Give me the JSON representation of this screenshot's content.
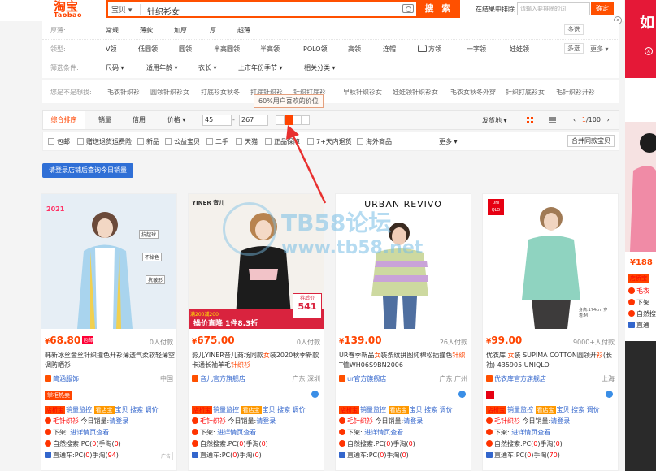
{
  "search": {
    "logo_cn": "淘宝",
    "logo_en": "Taobao",
    "category": "宝贝",
    "query": "针织衫女",
    "button": "搜 索",
    "exclude_label": "在结果中排除",
    "exclude_placeholder": "请输入要排除的词",
    "exclude_button": "确定",
    "close": "×"
  },
  "filters": {
    "row1": {
      "options": [
        "常规",
        "薄款",
        "加厚",
        "厚",
        "超薄"
      ],
      "more": "多选"
    },
    "row2": {
      "label": "领型:",
      "options": [
        "V领",
        "低圆领",
        "圆领",
        "半高圆领",
        "半高领",
        "POLO领",
        "高领",
        "连帽",
        "方领",
        "一字领",
        "娃娃领"
      ],
      "multi": "多选",
      "more": "更多"
    },
    "row3": {
      "label": "筛选条件:",
      "options": [
        "尺码",
        "适用年龄",
        "衣长",
        "上市年份季节",
        "相关分类"
      ]
    }
  },
  "suggest": {
    "label": "您是不是想找:",
    "items": [
      "毛衣针织衫",
      "圆领针织衫女",
      "打底衫女秋冬",
      "打底针织衫",
      "针织打底衫",
      "早秋针织衫女",
      "娃娃领针织衫女",
      "毛衣女秋冬外穿",
      "针织打底衫女",
      "毛针织衫开衫"
    ]
  },
  "tooltip": "60%用户喜欢的价位",
  "sortbar": {
    "tabs": [
      "综合排序",
      "销量",
      "信用",
      "价格"
    ],
    "price_min": "45",
    "price_max": "267",
    "dash": "-",
    "ship_from": "发货地",
    "page_current": "1",
    "page_total": "/100"
  },
  "checks": [
    "包邮",
    "赠送退货运费险",
    "新品",
    "公益宝贝",
    "二手",
    "天猫",
    "正品保障",
    "7+天内退货",
    "海外商品"
  ],
  "checks_more": "更多",
  "merge_button": "合并同款宝贝",
  "login_button": "请登录店铺后查询今日销量",
  "products": [
    {
      "price": "68.80",
      "badge": "包邮",
      "paid": "0人付款",
      "title_parts": [
        "韩新冰丝金丝针织撞色开衫薄透气柔软轻薄空调防晒衫"
      ],
      "shop": "简涵服饰",
      "location": "中国",
      "hot": "掌柜热卖",
      "img_year": "2021",
      "img_tags": [
        "抗起球",
        "不掉色",
        "抗皱形"
      ],
      "pc": "0",
      "mobile": "0",
      "ztc_pc": "0",
      "ztc_mobile": "94",
      "ad": "广告"
    },
    {
      "price": "675.00",
      "paid": "0人付款",
      "title_parts": [
        "影儿YINER音儿商场同款",
        "女",
        "装2020秋季新款卡通长袖羊毛",
        "针织衫"
      ],
      "shop": "音儿官方旗舰店",
      "location": "广东 深圳",
      "img_brand": "YINER 音儿",
      "img_banner": "券后价",
      "img_price": "541",
      "img_promo": "操价直降 1件8.3折",
      "img_coupon": "满200减200",
      "pc": "0",
      "mobile": "0",
      "ztc_pc": "0",
      "ztc_mobile": "0"
    },
    {
      "price": "139.00",
      "paid": "26人付款",
      "title_parts": [
        "UR春季新品",
        "女",
        "装条纹拼图纯棉松插撞色",
        "针织",
        "T恤WH06S9BN2006"
      ],
      "shop": "ur官方旗舰店",
      "location": "广东 广州",
      "img_brand": "URBAN REVIVO",
      "pc": "0",
      "mobile": "0",
      "ztc_pc": "0",
      "ztc_mobile": "0"
    },
    {
      "price": "99.00",
      "paid": "9000+人付款",
      "title_parts": [
        "优衣库 ",
        "女",
        "装 SUPIMA COTTON圆领开",
        "衫",
        "(长袖) 435905 UNIQLO"
      ],
      "shop": "优衣库官方旗舰店",
      "location": "上海",
      "img_brand": "UNI QLO",
      "img_note": "身高:174cm 穿着:M",
      "pc": "0",
      "mobile": "0",
      "ztc_pc": "0",
      "ztc_mobile": "70"
    }
  ],
  "tools": {
    "shop_analysis": "店析宝",
    "sales_monitor": "销量监控",
    "view_shop": "看店宝",
    "item_label": "宝贝",
    "search_label": "搜索",
    "price_label": "调价",
    "keyword_prefix": "毛针织衫",
    "today_sales": "今日销量:",
    "please_login": "请登录",
    "delist": "下架:",
    "delist_link": "进详情页查看",
    "natural": "自然搜索:",
    "ztc": "直通车:",
    "pc": "PC(",
    "mobile": ")手淘(",
    "close_paren": ")"
  },
  "right_strip": {
    "ad_char": "如",
    "price1": "¥188",
    "tag": "店侨宝",
    "line1": "毛衣",
    "line2": "下架",
    "line3": "自然搜",
    "line4": "直通"
  },
  "watermark": {
    "t1": "TB58论坛",
    "t2": "www.tb58.net"
  },
  "colors": {
    "accent": "#ff4400",
    "blue": "#2f6fd6",
    "link": "#3366cc"
  }
}
